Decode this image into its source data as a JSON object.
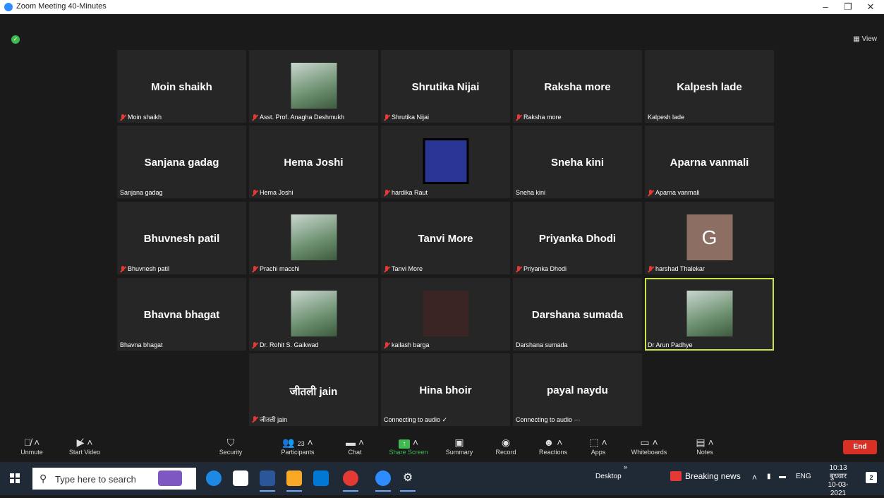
{
  "window": {
    "title": "Zoom Meeting 40-Minutes"
  },
  "top": {
    "view_label": "View"
  },
  "tiles": [
    {
      "name": "Moin shaikh",
      "label": "Moin shaikh",
      "muted": true,
      "kind": "name"
    },
    {
      "name": "",
      "label": "Asst. Prof. Anagha Deshmukh",
      "muted": true,
      "kind": "photo"
    },
    {
      "name": "Shrutika Nijai",
      "label": "Shrutika Nijai",
      "muted": true,
      "kind": "name"
    },
    {
      "name": "Raksha more",
      "label": "Raksha more",
      "muted": true,
      "kind": "name"
    },
    {
      "name": "Kalpesh lade",
      "label": "Kalpesh lade",
      "muted": false,
      "kind": "name"
    },
    {
      "name": "Sanjana gadag",
      "label": "Sanjana gadag",
      "muted": false,
      "kind": "name"
    },
    {
      "name": "Hema Joshi",
      "label": "Hema Joshi",
      "muted": true,
      "kind": "name"
    },
    {
      "name": "",
      "label": "hardika Raut",
      "muted": true,
      "kind": "screen"
    },
    {
      "name": "Sneha kini",
      "label": "Sneha kini",
      "muted": false,
      "kind": "name"
    },
    {
      "name": "Aparna vanmali",
      "label": "Aparna vanmali",
      "muted": true,
      "kind": "name"
    },
    {
      "name": "Bhuvnesh patil",
      "label": "Bhuvnesh patil",
      "muted": true,
      "kind": "name"
    },
    {
      "name": "",
      "label": "Prachi macchi",
      "muted": true,
      "kind": "photo"
    },
    {
      "name": "Tanvi More",
      "label": "Tanvi More",
      "muted": true,
      "kind": "name"
    },
    {
      "name": "Priyanka Dhodi",
      "label": "Priyanka Dhodi",
      "muted": true,
      "kind": "name"
    },
    {
      "name": "G",
      "label": "harshad Thalekar",
      "muted": true,
      "kind": "avatar"
    },
    {
      "name": "Bhavna bhagat",
      "label": "Bhavna bhagat",
      "muted": false,
      "kind": "name"
    },
    {
      "name": "",
      "label": "Dr. Rohit S. Gaikwad",
      "muted": true,
      "kind": "photo"
    },
    {
      "name": "",
      "label": "kailash barga",
      "muted": true,
      "kind": "dark"
    },
    {
      "name": "Darshana sumada",
      "label": "Darshana sumada",
      "muted": false,
      "kind": "name"
    },
    {
      "name": "",
      "label": "Dr Arun Padhye",
      "muted": false,
      "kind": "photo",
      "active": true
    },
    {
      "name": "जीतली jain",
      "label": "जीतली jain",
      "muted": true,
      "kind": "name"
    },
    {
      "name": "Hina bhoir",
      "label": "Connecting to audio ✓",
      "muted": false,
      "kind": "name"
    },
    {
      "name": "payal naydu",
      "label": "Connecting to audio ⋯",
      "muted": false,
      "kind": "name"
    }
  ],
  "toolbar": {
    "unmute": "Unmute",
    "start_video": "Start Video",
    "security": "Security",
    "participants": "Participants",
    "participants_count": "23",
    "chat": "Chat",
    "share_screen": "Share Screen",
    "summary": "Summary",
    "record": "Record",
    "reactions": "Reactions",
    "apps": "Apps",
    "whiteboards": "Whiteboards",
    "notes": "Notes",
    "end": "End"
  },
  "taskbar": {
    "search_placeholder": "Type here to search",
    "desktop": "Desktop",
    "breaking_news": "Breaking news",
    "lang": "ENG",
    "time": "10:13",
    "day": "बुधवार",
    "date": "10-03-2021",
    "notif_count": "2"
  },
  "colors": {
    "accent_green": "#3fb950",
    "end_red": "#d93025",
    "active_border": "#c8e64b",
    "avatar_bg": "#8d6e63"
  }
}
